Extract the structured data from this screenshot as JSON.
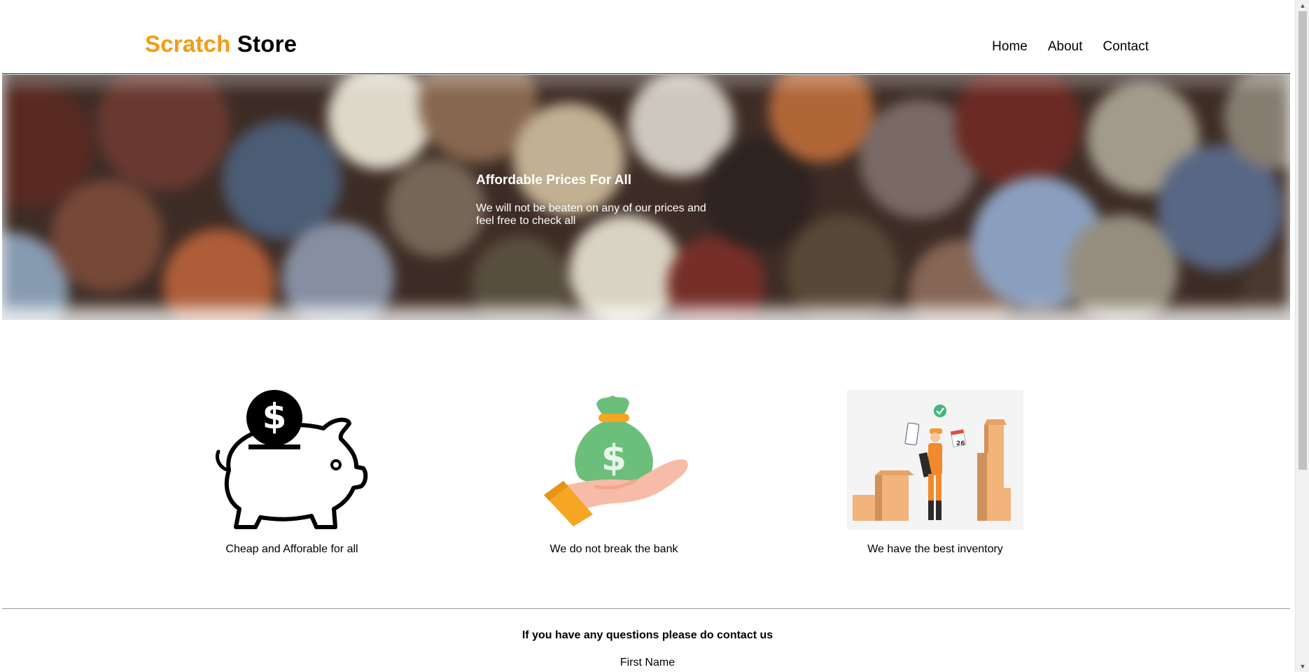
{
  "header": {
    "logo_accent": "Scratch",
    "logo_rest": " Store",
    "accent_color": "#f39c12",
    "nav": [
      "Home",
      "About",
      "Contact"
    ]
  },
  "hero": {
    "title": "Affordable Prices For All",
    "subtitle": "We will not be beaten on any of our prices and feel free to check all"
  },
  "features": [
    {
      "icon": "piggy-bank-icon",
      "caption": "Cheap and Afforable for all"
    },
    {
      "icon": "money-bag-hand-icon",
      "caption": "We do not break the bank"
    },
    {
      "icon": "inventory-worker-icon",
      "caption": "We have the best inventory"
    }
  ],
  "contact": {
    "title": "If you have any questions please do contact us",
    "first_name_label": "First Name"
  }
}
